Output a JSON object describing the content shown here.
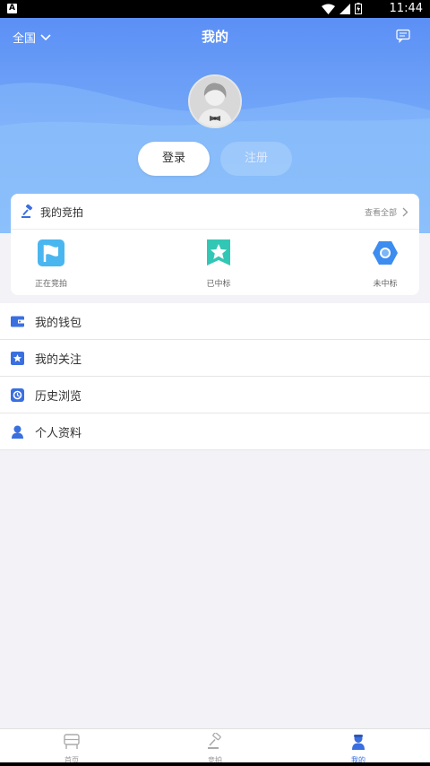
{
  "status_bar": {
    "time": "11:44",
    "indicator": "A"
  },
  "header": {
    "region": "全国",
    "title": "我的"
  },
  "auth": {
    "login": "登录",
    "register": "注册"
  },
  "auction": {
    "title": "我的竞拍",
    "view_all": "查看全部",
    "statuses": [
      {
        "label": "正在竞拍",
        "icon": "flag-icon"
      },
      {
        "label": "已中标",
        "icon": "star-badge-icon"
      },
      {
        "label": "未中标",
        "icon": "hexagon-icon"
      }
    ]
  },
  "menu": [
    {
      "label": "我的钱包",
      "icon": "wallet-icon"
    },
    {
      "label": "我的关注",
      "icon": "star-icon"
    },
    {
      "label": "历史浏览",
      "icon": "history-icon"
    },
    {
      "label": "个人资料",
      "icon": "user-icon"
    }
  ],
  "tabs": [
    {
      "label": "首页",
      "icon": "home-icon",
      "active": false
    },
    {
      "label": "竞拍",
      "icon": "gavel-icon",
      "active": false
    },
    {
      "label": "我的",
      "icon": "profile-icon",
      "active": true
    }
  ],
  "colors": {
    "accent": "#3a6fe0",
    "header_top": "#5b8ff5",
    "header_bottom": "#88bffb"
  }
}
